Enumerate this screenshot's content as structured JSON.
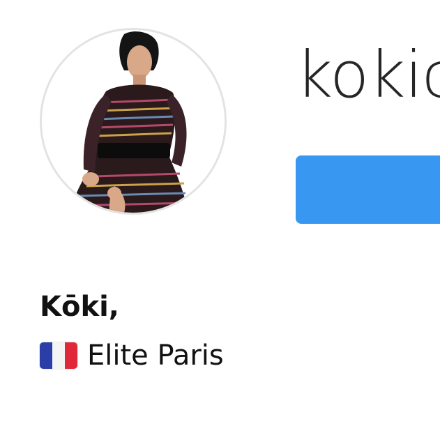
{
  "profile": {
    "username": "kokic",
    "avatar_icon": "profile-photo",
    "follow_button": {
      "label": "",
      "color": "#3897f0"
    },
    "display_name": "Kōki,",
    "bio": {
      "flag_icon": "france-flag-icon",
      "text": "Elite Paris"
    }
  }
}
